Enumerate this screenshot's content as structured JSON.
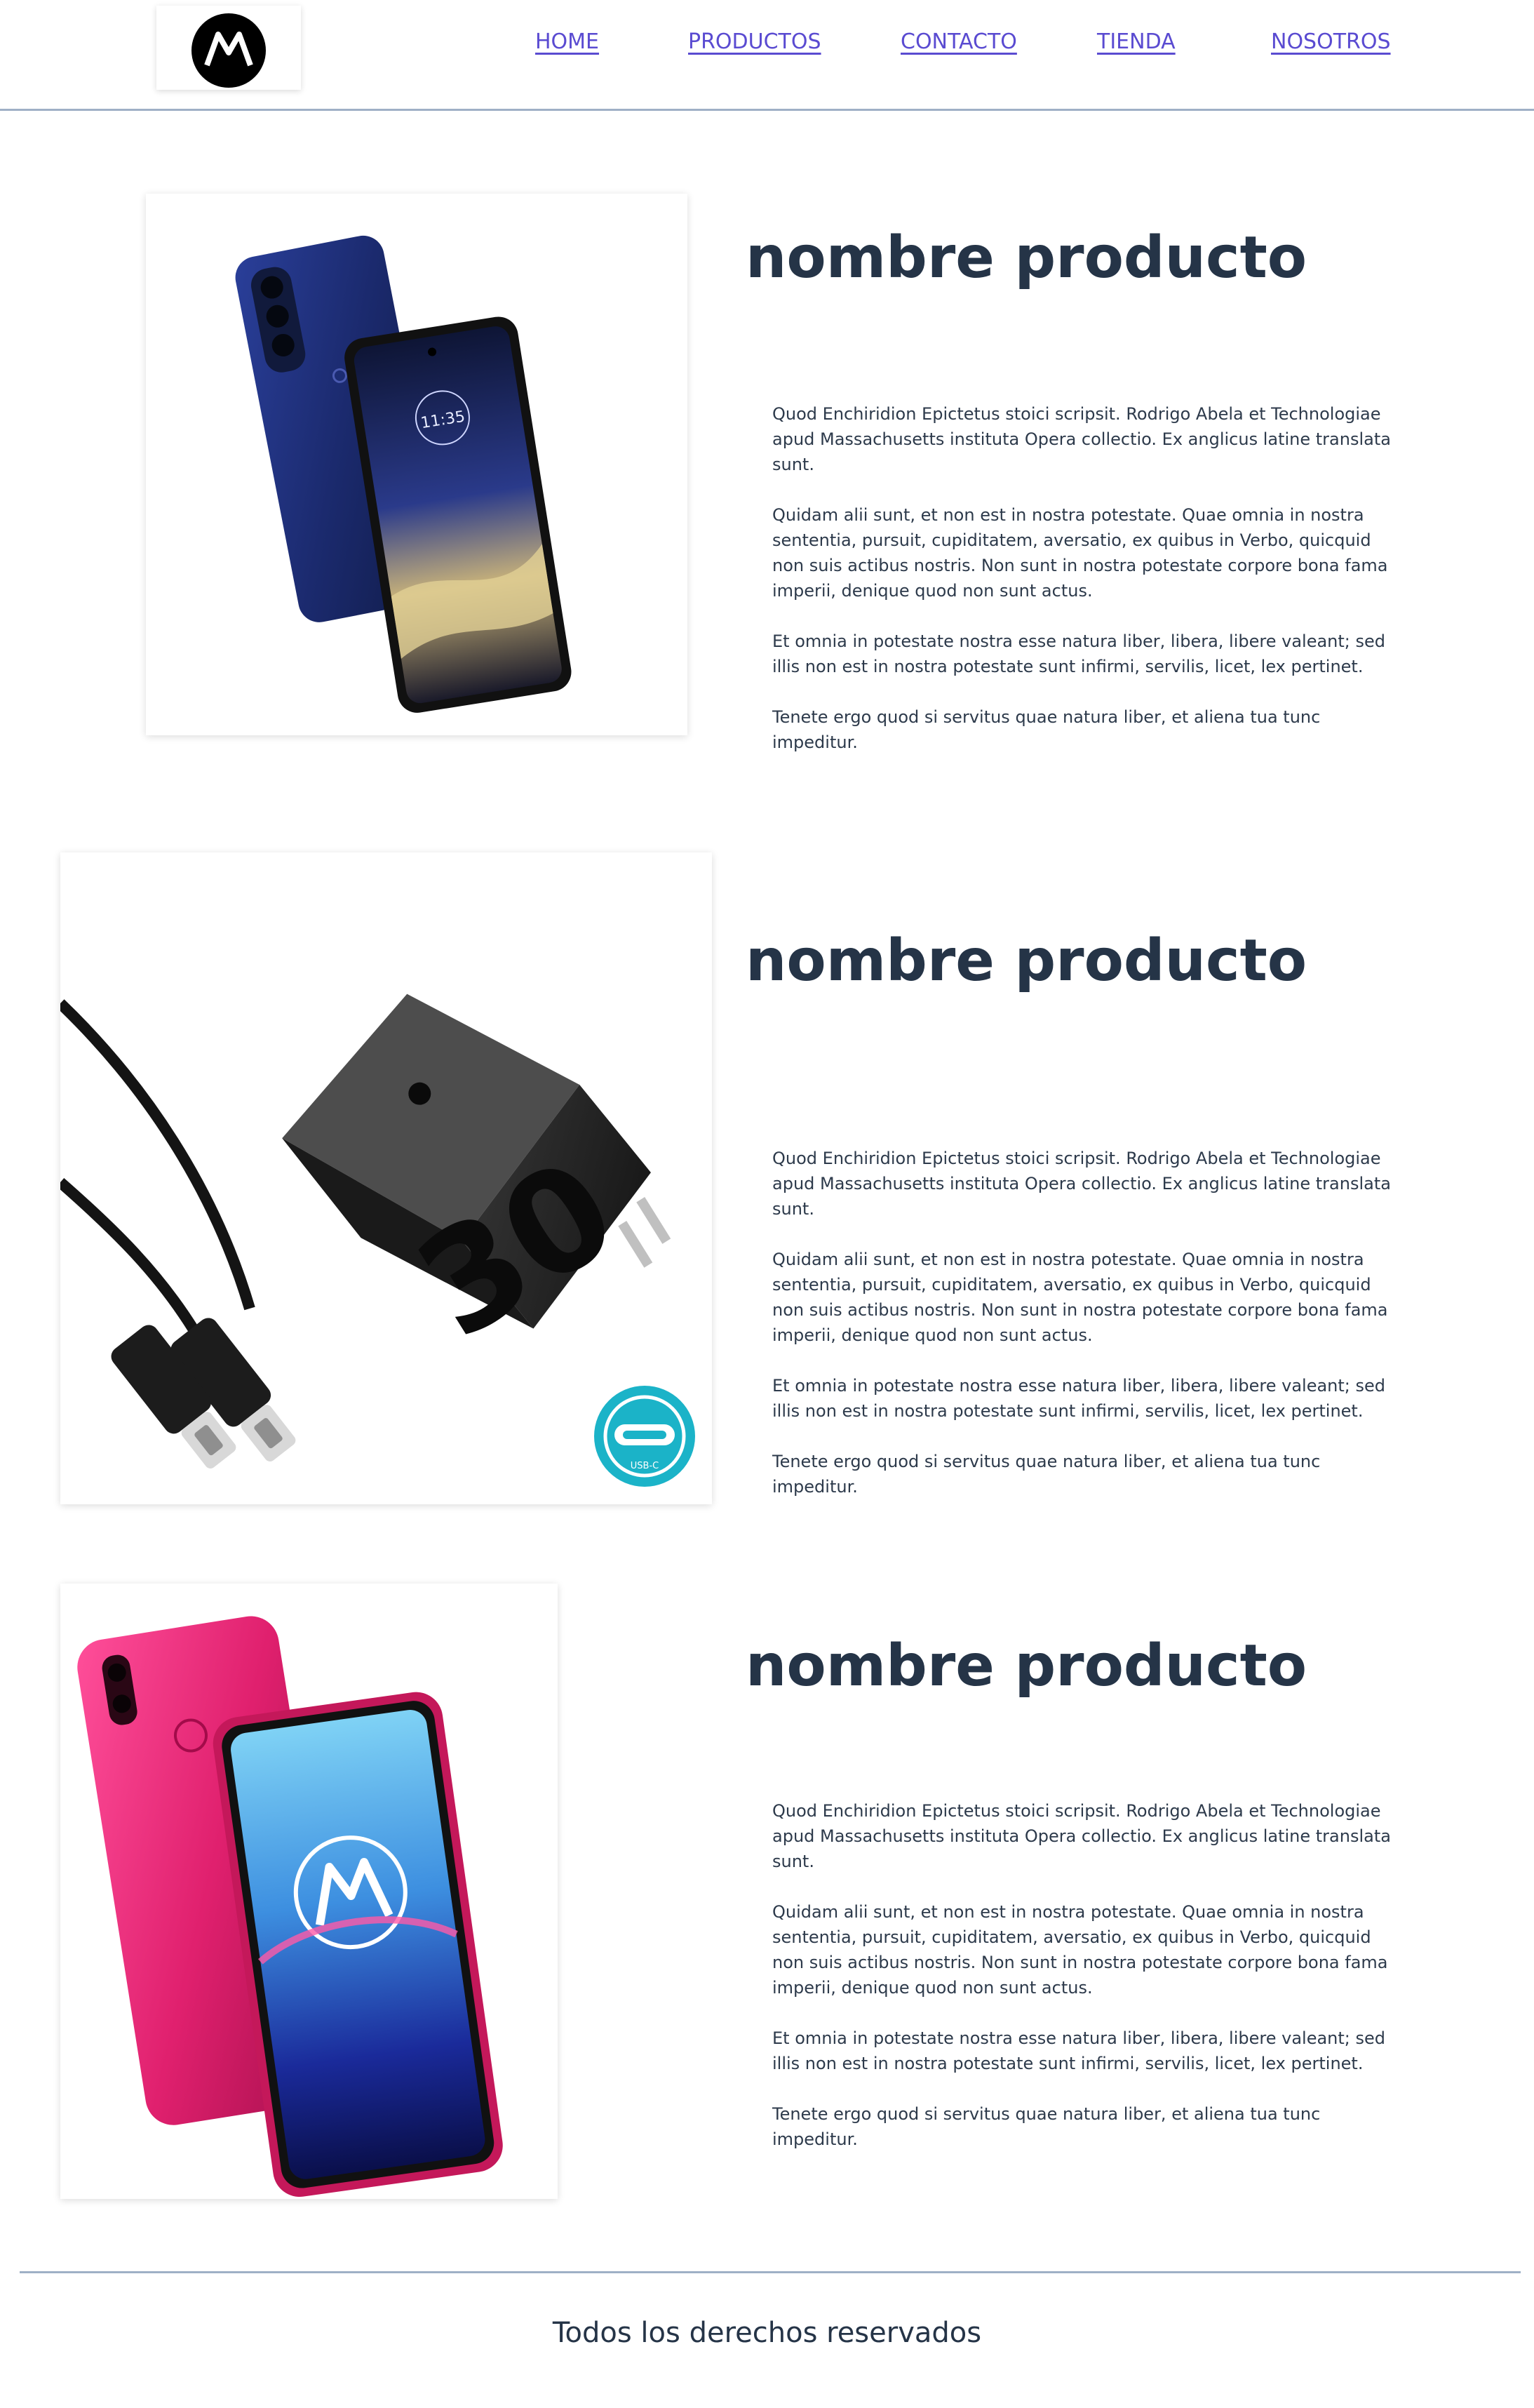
{
  "nav": [
    {
      "label": "HOME"
    },
    {
      "label": "PRODUCTOS"
    },
    {
      "label": "CONTACTO"
    },
    {
      "label": "TIENDA"
    },
    {
      "label": "NOSOTROS"
    }
  ],
  "products": [
    {
      "title": "nombre producto",
      "image": "blue-smartphone",
      "paragraphs": [
        "Quod Enchiridion Epictetus stoici scripsit. Rodrigo Abela et Technologiae apud Massachusetts instituta Opera collectio. Ex anglicus latine translata sunt.",
        "Quidam alii sunt, et non est in nostra potestate. Quae omnia in nostra sententia, pursuit, cupiditatem, aversatio, ex quibus in Verbo, quicquid non suis actibus nostris. Non sunt in nostra potestate corpore bona fama imperii, denique quod non sunt actus.",
        "Et omnia in potestate nostra esse natura liber, libera, libere valeant; sed illis non est in nostra potestate sunt infirmi, servilis, licet, lex pertinet.",
        "Tenete ergo quod si servitus quae natura liber, et aliena tua tunc impeditur."
      ]
    },
    {
      "title": "nombre producto",
      "image": "charger-and-usb-c-cable",
      "badge_text": "USB-C",
      "charger_mark": "30",
      "paragraphs": [
        "Quod Enchiridion Epictetus stoici scripsit. Rodrigo Abela et Technologiae apud Massachusetts instituta Opera collectio. Ex anglicus latine translata sunt.",
        "Quidam alii sunt, et non est in nostra potestate. Quae omnia in nostra sententia, pursuit, cupiditatem, aversatio, ex quibus in Verbo, quicquid non suis actibus nostris. Non sunt in nostra potestate corpore bona fama imperii, denique quod non sunt actus.",
        "Et omnia in potestate nostra esse natura liber, libera, libere valeant; sed illis non est in nostra potestate sunt infirmi, servilis, licet, lex pertinet.",
        "Tenete ergo quod si servitus quae natura liber, et aliena tua tunc impeditur."
      ]
    },
    {
      "title": "nombre producto",
      "image": "pink-smartphone",
      "paragraphs": [
        "Quod Enchiridion Epictetus stoici scripsit. Rodrigo Abela et Technologiae apud Massachusetts instituta Opera collectio. Ex anglicus latine translata sunt.",
        "Quidam alii sunt, et non est in nostra potestate. Quae omnia in nostra sententia, pursuit, cupiditatem, aversatio, ex quibus in Verbo, quicquid non suis actibus nostris. Non sunt in nostra potestate corpore bona fama imperii, denique quod non sunt actus.",
        "Et omnia in potestate nostra esse natura liber, libera, libere valeant; sed illis non est in nostra potestate sunt infirmi, servilis, licet, lex pertinet.",
        "Tenete ergo quod si servitus quae natura liber, et aliena tua tunc impeditur."
      ]
    }
  ],
  "footer": {
    "text": "Todos los derechos reservados"
  },
  "colors": {
    "nav_link": "#5a4bd1",
    "heading": "#253447",
    "rule": "#9fb0c6",
    "badge": "#1bb3c8"
  }
}
